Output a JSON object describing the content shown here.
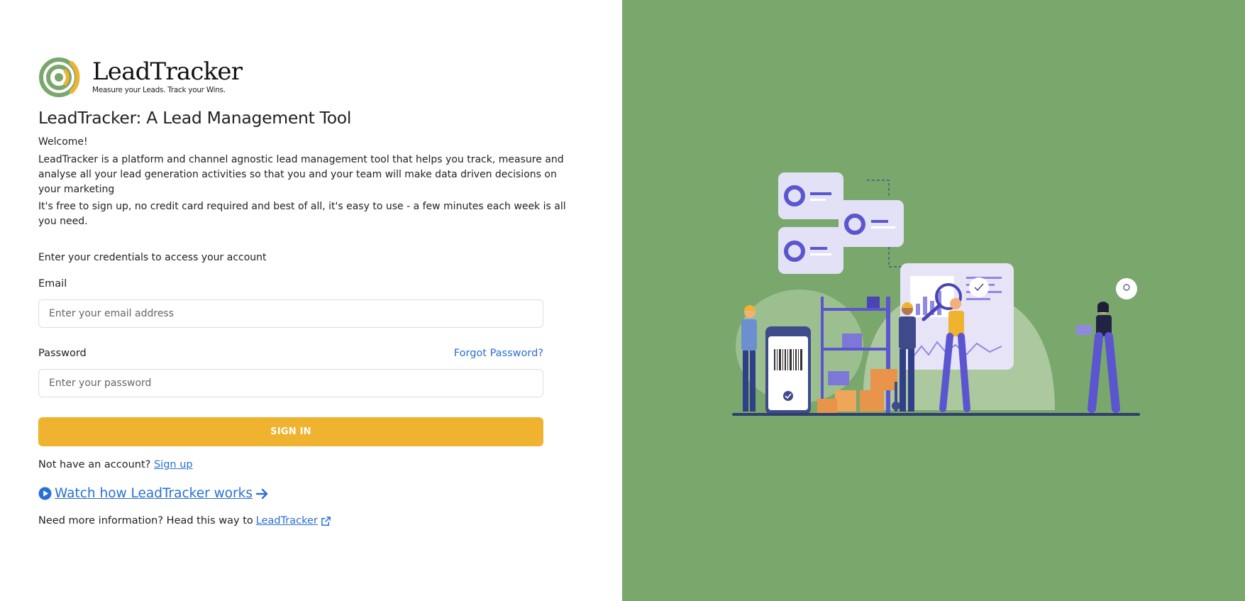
{
  "colors": {
    "accent": "#f0b32f",
    "panel": "#7aa76c",
    "link": "#2a6fd6"
  },
  "brand": {
    "name": "LeadTracker",
    "tagline": "Measure your Leads. Track your Wins."
  },
  "heading": "LeadTracker: A Lead Management Tool",
  "intro": {
    "welcome": "Welcome!",
    "description": "LeadTracker is a platform and channel agnostic lead management tool that helps you track, measure and analyse all your lead generation activities so that you and your team will make data driven decisions on your marketing",
    "free_note": "It's free to sign up, no credit card required and best of all, it's easy to use - a few minutes each week is all you need."
  },
  "form": {
    "instruction": "Enter your credentials to access your account",
    "email_label": "Email",
    "email_placeholder": "Enter your email address",
    "password_label": "Password",
    "forgot_password": "Forgot Password?",
    "password_placeholder": "Enter your password",
    "submit": "SIGN IN"
  },
  "signup": {
    "prompt": "Not have an account?",
    "link": "Sign up"
  },
  "watch": {
    "label": "Watch how LeadTracker works",
    "play_icon": "play-circle-icon",
    "arrow_icon": "arrow-right-icon"
  },
  "more_info": {
    "prompt": "Need more information? Head this way to",
    "link": "LeadTracker",
    "icon": "external-link-icon"
  },
  "illustration": {
    "name": "warehouse-analytics-illustration"
  }
}
